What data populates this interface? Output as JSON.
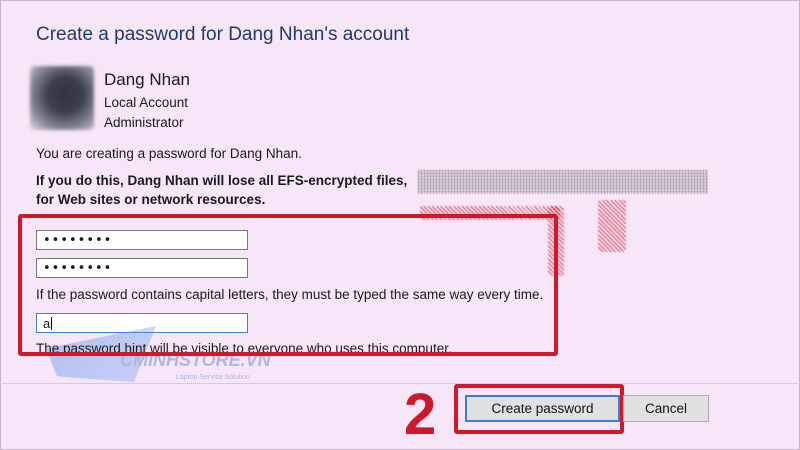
{
  "dialog": {
    "title": "Create a password for Dang Nhan's account"
  },
  "user": {
    "name": "Dang Nhan",
    "account_type": "Local Account",
    "role": "Administrator"
  },
  "messages": {
    "intro": "You are creating a password for Dang Nhan.",
    "warning_line1": "If you do this, Dang Nhan will lose all EFS-encrypted files,",
    "warning_line2": "for Web sites or network resources.",
    "case_note": "If the password contains capital letters, they must be typed the same way every time.",
    "hint_note": "The password hint will be visible to everyone who uses this computer."
  },
  "fields": {
    "new_password_value": "••••••••",
    "confirm_password_value": "••••••••",
    "hint_value": "a"
  },
  "annotation": {
    "step_number": "2",
    "highlight_color": "#d0182b"
  },
  "watermark": {
    "brand": "CMINHSTORE.VN",
    "tagline": "Laptop Service Solution"
  },
  "buttons": {
    "create_label": "Create password",
    "cancel_label": "Cancel"
  },
  "colors": {
    "background": "#f7e6f7",
    "title": "#1f3a6b",
    "focus_blue": "#3c7fd1"
  }
}
